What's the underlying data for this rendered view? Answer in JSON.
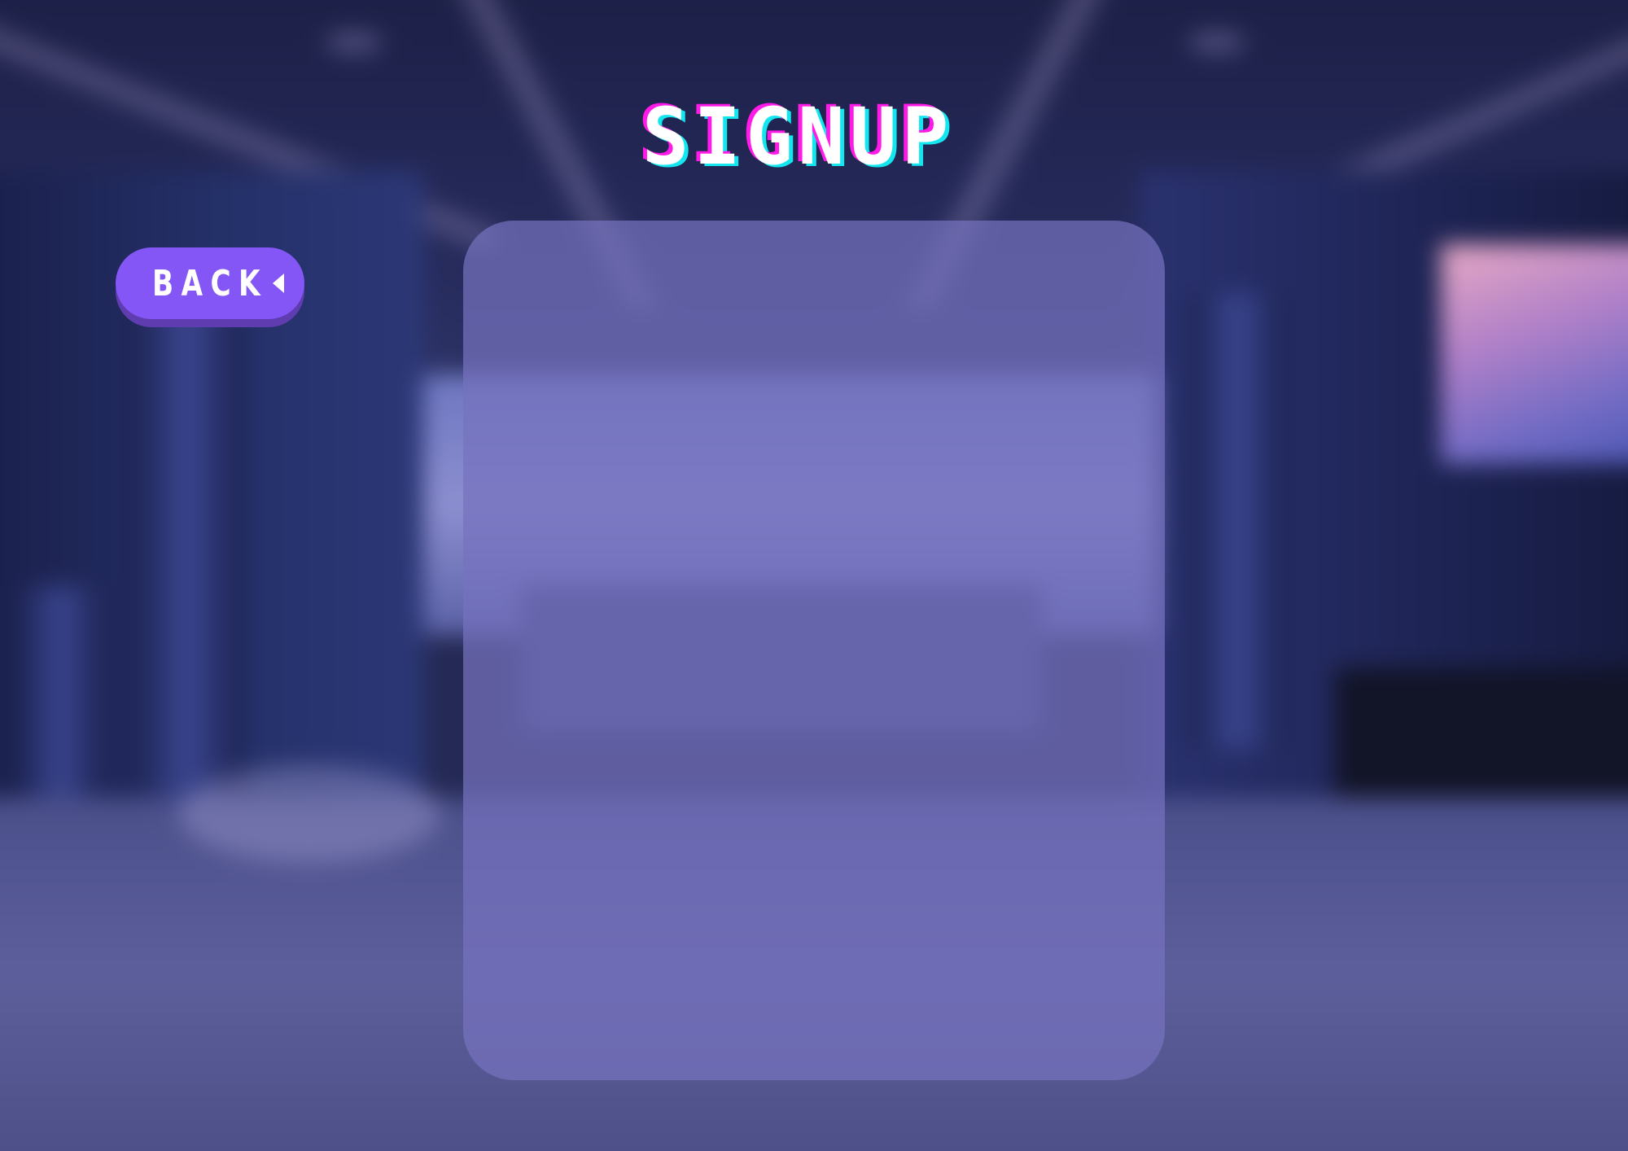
{
  "page": {
    "title": "SIGNUP"
  },
  "back_button": {
    "label": "BACK",
    "icon": "caret-left-icon"
  },
  "colors": {
    "accent": "#8456f6",
    "title_shadow_pink": "#ff1ae8",
    "title_shadow_cyan": "#14e6f0",
    "panel": "#7672be"
  }
}
